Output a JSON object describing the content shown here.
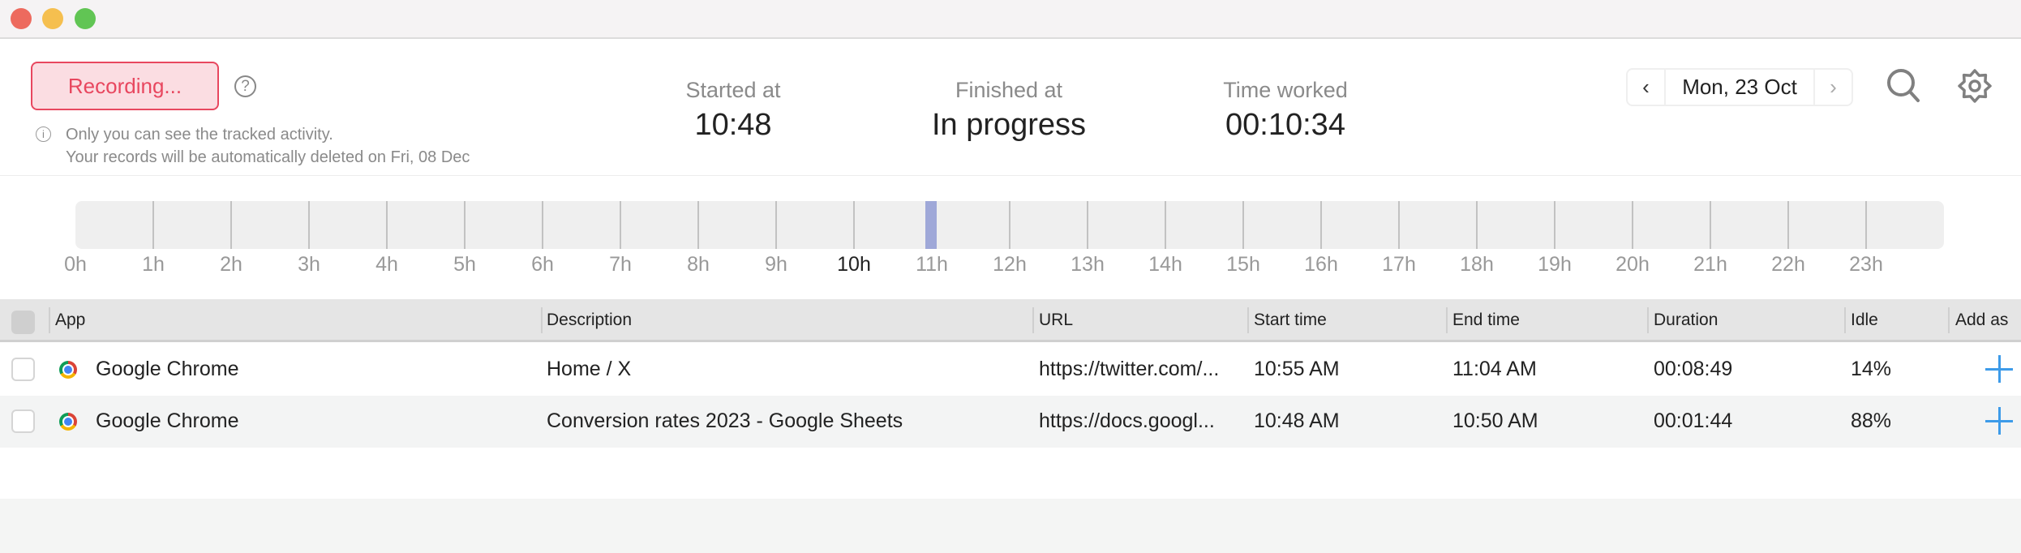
{
  "colors": {
    "recording": "#e8475f",
    "accent": "#3d9be9",
    "activity": "#9fa8d8"
  },
  "header": {
    "recording_label": "Recording...",
    "help_icon": "question-circle-icon",
    "info_line1": "Only you can see the tracked activity.",
    "info_line2": "Your records will be automatically deleted on Fri, 08 Dec",
    "started_label": "Started at",
    "started_value": "10:48",
    "finished_label": "Finished at",
    "finished_value": "In progress",
    "worked_label": "Time worked",
    "worked_value": "00:10:34",
    "date": "Mon, 23 Oct",
    "prev": "‹",
    "next": "›"
  },
  "timeline": {
    "hours": [
      "0h",
      "1h",
      "2h",
      "3h",
      "4h",
      "5h",
      "6h",
      "7h",
      "8h",
      "9h",
      "10h",
      "11h",
      "12h",
      "13h",
      "14h",
      "15h",
      "16h",
      "17h",
      "18h",
      "19h",
      "20h",
      "21h",
      "22h",
      "23h"
    ],
    "current_hour": "10h",
    "activity": [
      {
        "start": "10:55",
        "end": "11:04"
      }
    ]
  },
  "table": {
    "columns": [
      "App",
      "Description",
      "URL",
      "Start time",
      "End time",
      "Duration",
      "Idle",
      "Add as"
    ],
    "rows": [
      {
        "app": "Google Chrome",
        "description": "Home / X",
        "url": "https://twitter.com/...",
        "start": "10:55 AM",
        "end": "11:04 AM",
        "duration": "00:08:49",
        "idle": "14%"
      },
      {
        "app": "Google Chrome",
        "description": "Conversion rates 2023 - Google Sheets",
        "url": "https://docs.googl...",
        "start": "10:48 AM",
        "end": "10:50 AM",
        "duration": "00:01:44",
        "idle": "88%"
      }
    ]
  }
}
